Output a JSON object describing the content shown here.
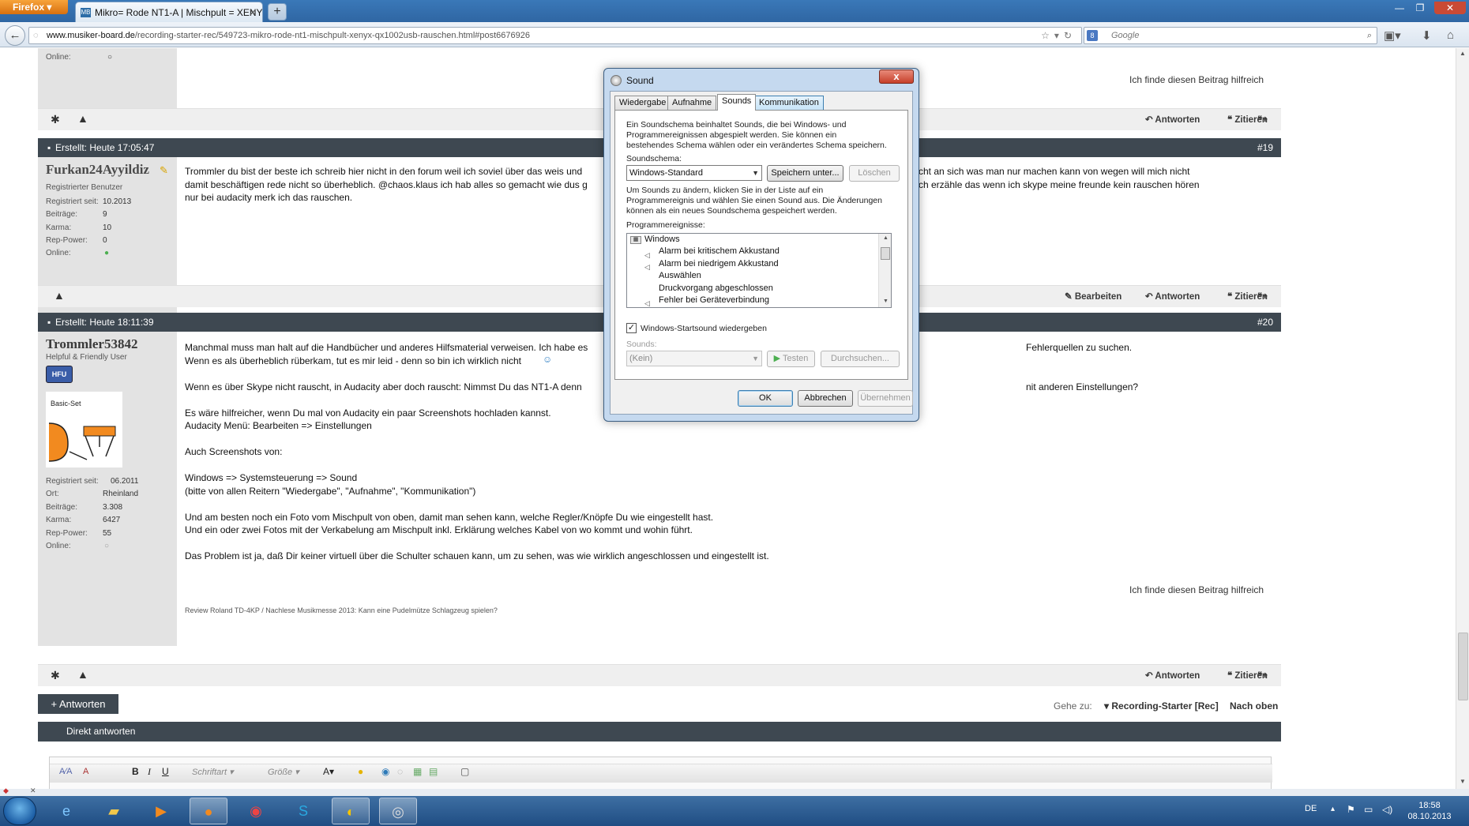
{
  "browser": {
    "menu_button": "Firefox",
    "tab_title": "Mikro= Rode NT1-A | Mischpult = XENY...",
    "tab_favicon": "MB",
    "new_tab": "+",
    "url_domain": "www.musiker-board.de",
    "url_path": "/recording-starter-rec/549723-mikro-rode-nt1-mischpult-xenyx-qx1002usb-rauschen.html#post6676926",
    "search_placeholder": "Google"
  },
  "posts": [
    {
      "id": "prev",
      "online_label": "Online:",
      "helpful": "Ich finde diesen Beitrag hilfreich",
      "actions": {
        "reply": "Antworten",
        "quote": "Zitieren"
      }
    },
    {
      "id": "19",
      "created": "Erstellt: Heute 17:05:47",
      "number": "#19",
      "username": "Furkan24Ayyildiz",
      "role": "Registrierter Benutzer",
      "stats": [
        {
          "label": "Registriert seit:",
          "value": "10.2013"
        },
        {
          "label": "Beiträge:",
          "value": "9"
        },
        {
          "label": "Karma:",
          "value": "10"
        },
        {
          "label": "Rep-Power:",
          "value": "0"
        },
        {
          "label": "Online:",
          "value": ""
        }
      ],
      "text": [
        "Trommler du bist der beste ich schreib hier nicht in den forum weil ich soviel über das weis und",
        "damit beschäftigen rede nicht so überheblich. @chaos.klaus ich hab alles so gemacht wie dus g",
        "nur bei audacity merk ich das rauschen."
      ],
      "text_right": [
        "cht an sich was man nur machen kann von wegen will mich nicht",
        "ch erzähle das wenn ich skype meine freunde kein rauschen hören"
      ],
      "actions": {
        "edit": "Bearbeiten",
        "reply": "Antworten",
        "quote": "Zitieren"
      }
    },
    {
      "id": "20",
      "created": "Erstellt: Heute 18:11:39",
      "number": "#20",
      "username": "Trommler53842",
      "role": "Helpful & Friendly User",
      "badge": "HFU",
      "avatar_caption": "Basic-Set",
      "stats": [
        {
          "label": "Registriert seit:",
          "value": "06.2011"
        },
        {
          "label": "Ort:",
          "value": "Rheinland"
        },
        {
          "label": "Beiträge:",
          "value": "3.308"
        },
        {
          "label": "Karma:",
          "value": "6427"
        },
        {
          "label": "Rep-Power:",
          "value": "55"
        },
        {
          "label": "Online:",
          "value": ""
        }
      ],
      "text": [
        "Manchmal muss man halt auf die Handbücher und anderes Hilfsmaterial verweisen. Ich habe es",
        "Wenn es als überheblich rüberkam, tut es mir leid - denn so bin ich wirklich nicht",
        "",
        "Wenn es über Skype nicht rauscht, in Audacity aber doch rauscht: Nimmst Du das NT1-A denn",
        "",
        "Es wäre hilfreicher, wenn Du mal von Audacity ein paar Screenshots hochladen kannst.",
        "Audacity Menü: Bearbeiten => Einstellungen",
        "",
        "Auch Screenshots von:",
        "",
        "Windows => Systemsteuerung => Sound",
        "(bitte von allen Reitern \"Wiedergabe\", \"Aufnahme\", \"Kommunikation\")",
        "",
        "Und am besten noch ein Foto vom Mischpult von oben, damit man sehen kann, welche Regler/Knöpfe Du wie eingestellt hast.",
        "Und ein oder zwei Fotos mit der Verkabelung am Mischpult inkl. Erklärung welches Kabel von wo kommt und wohin führt.",
        "",
        "Das Problem ist ja, daß Dir keiner virtuell über die Schulter schauen kann, um zu sehen, was wie wirklich angeschlossen und eingestellt ist."
      ],
      "text_right": [
        "Fehlerquellen zu suchen.",
        "nit anderen Einstellungen?"
      ],
      "helpful": "Ich finde diesen Beitrag hilfreich",
      "signature": "Review Roland TD-4KP / Nachlese Musikmesse 2013: Kann eine Pudelmütze Schlagzeug spielen?",
      "actions": {
        "reply": "Antworten",
        "quote": "Zitieren"
      }
    }
  ],
  "footer": {
    "reply_button": "+ Antworten",
    "goto_label": "Gehe zu:",
    "goto_target": "Recording-Starter [Rec]",
    "top_link": "Nach oben",
    "quick_reply": "Direkt antworten",
    "editor": {
      "font": "Schriftart",
      "size": "Größe"
    }
  },
  "dialog": {
    "title": "Sound",
    "close": "x",
    "tabs": [
      "Wiedergabe",
      "Aufnahme",
      "Sounds",
      "Kommunikation"
    ],
    "intro": [
      "Ein Soundschema beinhaltet Sounds, die bei Windows- und",
      "Programmereignissen abgespielt werden. Sie können ein",
      "bestehendes Schema wählen oder ein verändertes Schema speichern."
    ],
    "scheme_label": "Soundschema:",
    "scheme_value": "Windows-Standard",
    "save_as": "Speichern unter...",
    "delete": "Löschen",
    "change_text": [
      "Um Sounds zu ändern, klicken Sie in der Liste auf ein",
      "Programmereignis und wählen Sie einen Sound aus. Die Änderungen",
      "können als ein neues Soundschema gespeichert werden."
    ],
    "events_label": "Programmereignisse:",
    "events": [
      {
        "name": "Windows",
        "type": "group"
      },
      {
        "name": "Alarm bei kritischem Akkustand",
        "type": "sound"
      },
      {
        "name": "Alarm bei niedrigem Akkustand",
        "type": "sound"
      },
      {
        "name": "Auswählen",
        "type": "none"
      },
      {
        "name": "Druckvorgang abgeschlossen",
        "type": "none"
      },
      {
        "name": "Fehler bei Geräteverbindung",
        "type": "sound"
      }
    ],
    "startup_sound": "Windows-Startsound wiedergeben",
    "startup_checked": true,
    "sounds_label": "Sounds:",
    "sound_value": "(Kein)",
    "test": "Testen",
    "browse": "Durchsuchen...",
    "ok": "OK",
    "cancel": "Abbrechen",
    "apply": "Übernehmen"
  },
  "taskbar": {
    "lang": "DE",
    "time": "18:58",
    "date": "08.10.2013"
  }
}
